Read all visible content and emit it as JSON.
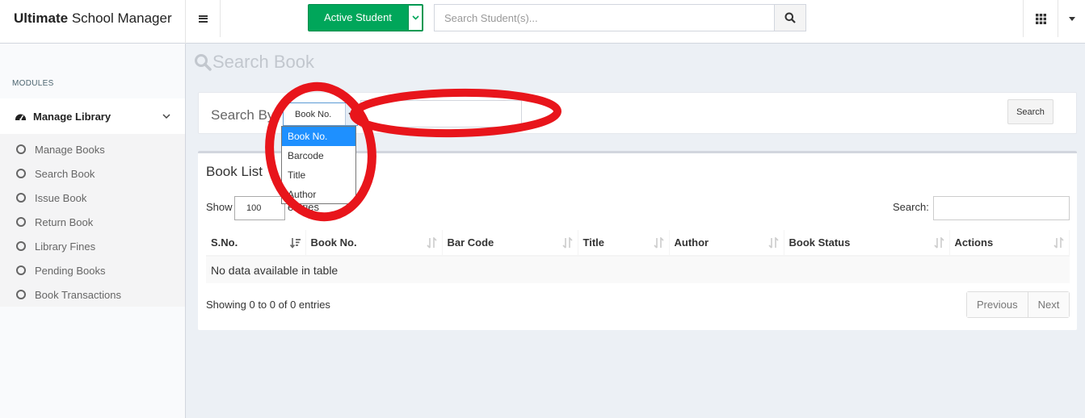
{
  "header": {
    "brand_bold": "Ultimate",
    "brand_rest": "School Manager",
    "active_student_label": "Active Student",
    "search_placeholder": "Search Student(s)..."
  },
  "sidebar": {
    "modules_label": "MODULES",
    "section_label": "Manage Library",
    "items": [
      {
        "label": "Manage Books"
      },
      {
        "label": "Search Book"
      },
      {
        "label": "Issue Book"
      },
      {
        "label": "Return Book"
      },
      {
        "label": "Library Fines"
      },
      {
        "label": "Pending Books"
      },
      {
        "label": "Book Transactions"
      }
    ]
  },
  "search_panel": {
    "title": "Search Book",
    "search_by_label": "Search By",
    "selected_option": "Book No.",
    "options": [
      "Book No.",
      "Barcode",
      "Title",
      "Author"
    ],
    "search_button": "Search"
  },
  "book_list": {
    "title": "Book List",
    "show_label": "Show",
    "page_length": "100",
    "entries_label": "entries",
    "search_label": "Search:",
    "columns": [
      "S.No.",
      "Book No.",
      "Bar Code",
      "Title",
      "Author",
      "Book Status",
      "Actions"
    ],
    "empty_message": "No data available in table",
    "info": "Showing 0 to 0 of 0 entries",
    "prev_label": "Previous",
    "next_label": "Next"
  },
  "colors": {
    "accent_green": "#00a65a",
    "annotation_red": "#e8151b",
    "dropdown_highlight": "#1e90ff"
  }
}
